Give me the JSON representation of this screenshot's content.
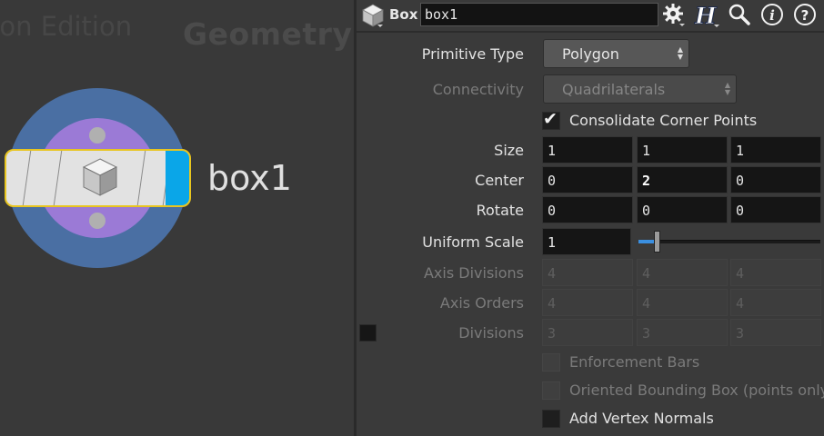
{
  "network": {
    "watermark": "tion Edition",
    "context": "Geometry",
    "node_name": "box1",
    "colors": {
      "outer_ring": "#4a6fa3",
      "inner_ring": "#9b7ad6",
      "selection": "#e8c51f",
      "display_flag": "#0aa6e8"
    }
  },
  "header": {
    "node_type": "Box",
    "node_name": "box1",
    "buttons": [
      "gear-icon",
      "houdini-help-icon",
      "search-icon",
      "info-icon",
      "help-icon"
    ]
  },
  "params": {
    "primitive_type": {
      "label": "Primitive Type",
      "value": "Polygon"
    },
    "connectivity": {
      "label": "Connectivity",
      "value": "Quadrilaterals"
    },
    "consolidate": {
      "label": "Consolidate Corner Points",
      "checked": true
    },
    "size": {
      "label": "Size",
      "x": "1",
      "y": "1",
      "z": "1"
    },
    "center": {
      "label": "Center",
      "x": "0",
      "y": "2",
      "z": "0"
    },
    "rotate": {
      "label": "Rotate",
      "x": "0",
      "y": "0",
      "z": "0"
    },
    "uniform_scale": {
      "label": "Uniform Scale",
      "value": "1",
      "slider_fraction": 0.1
    },
    "axis_divisions": {
      "label": "Axis Divisions",
      "x": "4",
      "y": "4",
      "z": "4"
    },
    "axis_orders": {
      "label": "Axis Orders",
      "x": "4",
      "y": "4",
      "z": "4"
    },
    "divisions": {
      "label": "Divisions",
      "x": "3",
      "y": "3",
      "z": "3"
    },
    "enforcement_bars": {
      "label": "Enforcement Bars"
    },
    "oriented_bbox": {
      "label": "Oriented Bounding Box (points only)"
    },
    "add_vertex_normals": {
      "label": "Add Vertex Normals"
    }
  }
}
